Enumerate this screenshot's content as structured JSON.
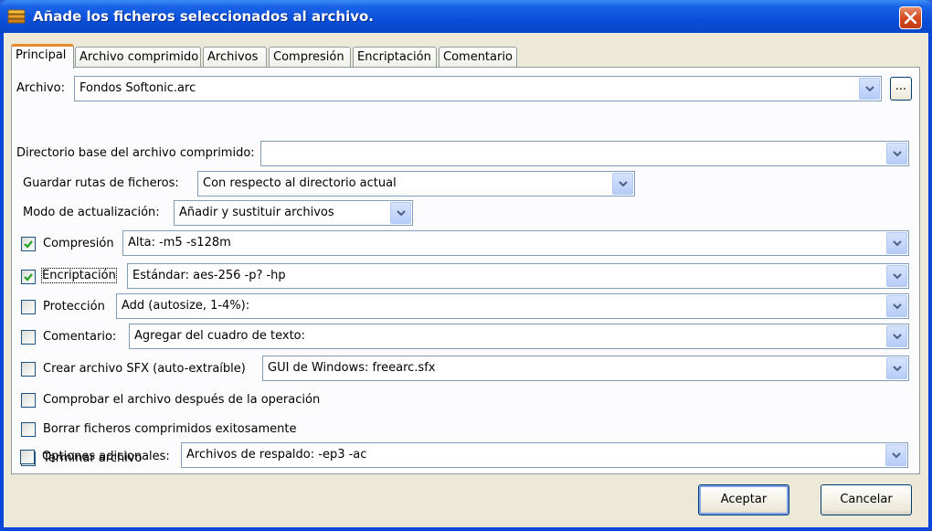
{
  "window": {
    "title": "Añade los ficheros seleccionados al archivo."
  },
  "tabs": [
    {
      "label": "Principal"
    },
    {
      "label": "Archivo comprimido"
    },
    {
      "label": "Archivos"
    },
    {
      "label": "Compresión"
    },
    {
      "label": "Encriptación"
    },
    {
      "label": "Comentario"
    }
  ],
  "archivo": {
    "label": "Archivo:",
    "value": "Fondos Softonic.arc",
    "browse": "..."
  },
  "directorio_base": {
    "label": "Directorio base del archivo comprimido:",
    "value": ""
  },
  "guardar_rutas": {
    "label": "Guardar rutas de ficheros:",
    "value": "Con respecto al directorio actual"
  },
  "modo_actualizacion": {
    "label": "Modo de actualización:",
    "value": "Añadir y sustituir archivos"
  },
  "compresion": {
    "label": "Compresión",
    "checked": true,
    "value": "Alta: -m5 -s128m"
  },
  "encriptacion": {
    "label": "Encriptación",
    "checked": true,
    "value": "Estándar: aes-256 -p? -hp"
  },
  "proteccion": {
    "label": "Protección",
    "checked": false,
    "value": "Add (autosize, 1-4%):"
  },
  "comentario": {
    "label": "Comentario:",
    "checked": false,
    "value": "Agregar del cuadro de texto:"
  },
  "sfx": {
    "label": "Crear archivo SFX (auto-extraíble)",
    "checked": false,
    "value": "GUI de Windows: freearc.sfx"
  },
  "comprobar": {
    "label": "Comprobar el archivo después de la operación",
    "checked": false
  },
  "borrar": {
    "label": "Borrar ficheros comprimidos exitosamente",
    "checked": false
  },
  "terminar": {
    "label": "Terminar archivo",
    "checked": false
  },
  "opciones": {
    "label": "Optiones adicionales:",
    "checked": false,
    "value": "Archivos de respaldo: -ep3 -ac"
  },
  "buttons": {
    "accept": "Aceptar",
    "cancel": "Cancelar"
  }
}
